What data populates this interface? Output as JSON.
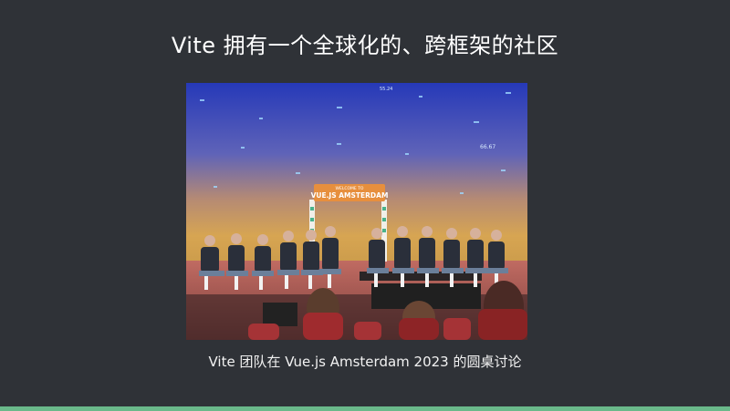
{
  "slide": {
    "title": "Vite 拥有一个全球化的、跨框架的社区",
    "caption": "Vite 团队在 Vue.js Amsterdam 2023 的圆桌讨论",
    "accent_color": "#6ab98a",
    "background_color": "#2f3237"
  },
  "photo": {
    "banner_small": "WELCOME TO",
    "banner_large": "VUE.JS AMSTERDAM",
    "screen_numbers": [
      "55.24",
      "66.67"
    ]
  }
}
